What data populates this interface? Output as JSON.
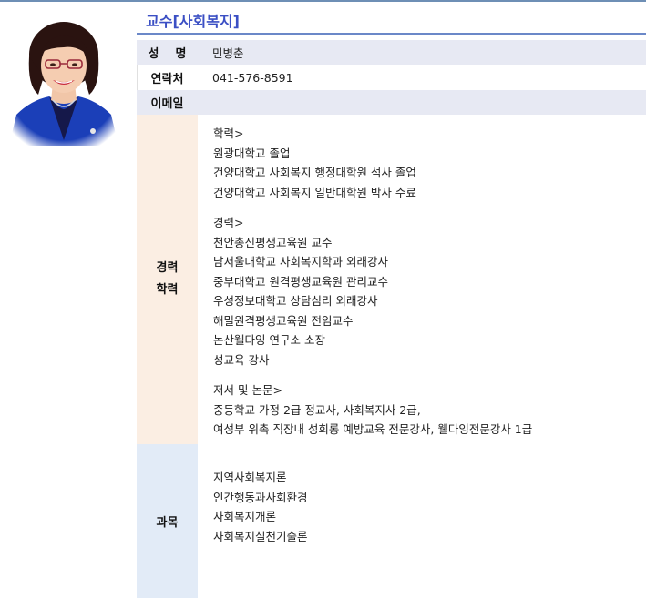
{
  "page": {
    "title": "교수[사회복지]"
  },
  "profile": {
    "name_label": "성    명",
    "name": "민병춘",
    "phone_label": "연락처",
    "phone": "041-576-8591",
    "email_label": "이메일",
    "email": ""
  },
  "career": {
    "label_line1": "경력",
    "label_line2": "학력",
    "education_heading": "학력>",
    "education": [
      "원광대학교 졸업",
      "건양대학교 사회복지 행정대학원 석사 졸업",
      "건양대학교 사회복지 일반대학원 박사 수료"
    ],
    "experience_heading": "경력>",
    "experience": [
      "천안총신평생교육원 교수",
      "남서울대학교 사회복지학과 외래강사",
      "중부대학교 원격평생교육원 관리교수",
      "우성정보대학교 상담심리 외래강사",
      "해밀원격평생교육원 전임교수",
      "논산웰다잉 연구소 소장",
      "성교육 강사"
    ],
    "works_heading": "저서 및 논문>",
    "works": [
      "중등학교 가정 2급 정교사, 사회복지사 2급,",
      "여성부 위촉 직장내 성희롱 예방교육 전문강사, 웰다잉전문강사 1급"
    ]
  },
  "courses": {
    "label": "과목",
    "items": [
      "지역사회복지론",
      "인간행동과사회환경",
      "사회복지개론",
      "사회복지실천기술론"
    ]
  },
  "colors": {
    "title": "#3b4fc4",
    "rule": "#6b88c8",
    "header_row_bg": "#e7e9f3",
    "career_label_bg": "#fbeee3",
    "course_label_bg": "#e2ebf7"
  }
}
